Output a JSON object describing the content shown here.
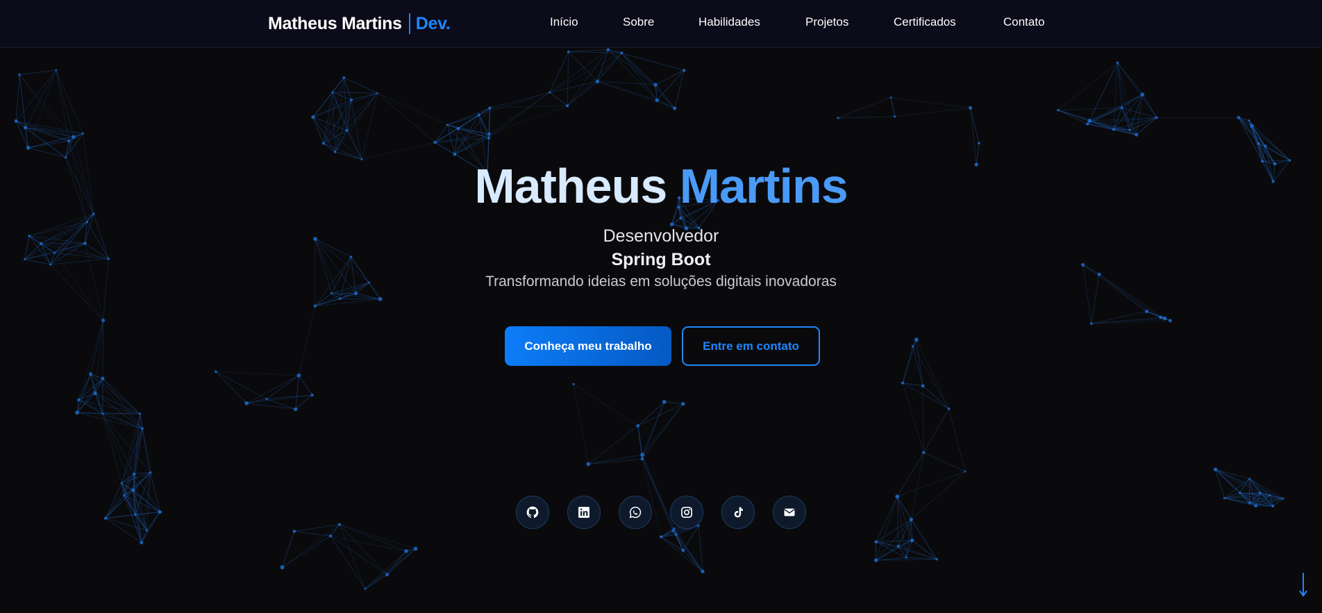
{
  "navbar": {
    "brand_name": "Matheus Martins",
    "brand_suffix": "Dev.",
    "links": [
      "Início",
      "Sobre",
      "Habilidades",
      "Projetos",
      "Certificados",
      "Contato"
    ]
  },
  "hero": {
    "first_name": "Matheus",
    "last_name": "Martins",
    "role": "Desenvolvedor",
    "stack": "Spring Boot",
    "tagline": "Transformando ideias em soluções digitais inovadoras",
    "primary_button": "Conheça meu trabalho",
    "secondary_button": "Entre em contato"
  },
  "socials": [
    "github-icon",
    "linkedin-icon",
    "whatsapp-icon",
    "instagram-icon",
    "tiktok-icon",
    "email-icon"
  ],
  "colors": {
    "background": "#0a0a0c",
    "navbar": "#0b0b19",
    "accent": "#1f86ff",
    "title_light": "#d8eaff",
    "title_blue": "#4a9af7"
  },
  "scroll_indicator": "arrow-down-icon"
}
